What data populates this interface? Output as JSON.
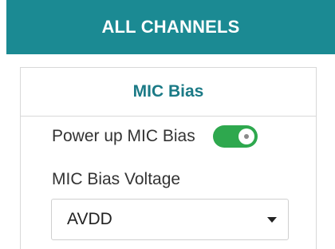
{
  "header": {
    "title": "ALL CHANNELS"
  },
  "panel": {
    "title": "MIC Bias",
    "power": {
      "label": "Power up MIC Bias",
      "enabled": true
    },
    "voltage": {
      "label": "MIC Bias Voltage",
      "selected": "AVDD"
    }
  },
  "colors": {
    "header_bg": "#1b8a93",
    "title_text": "#1b7a86",
    "toggle_on": "#2ea84e"
  }
}
